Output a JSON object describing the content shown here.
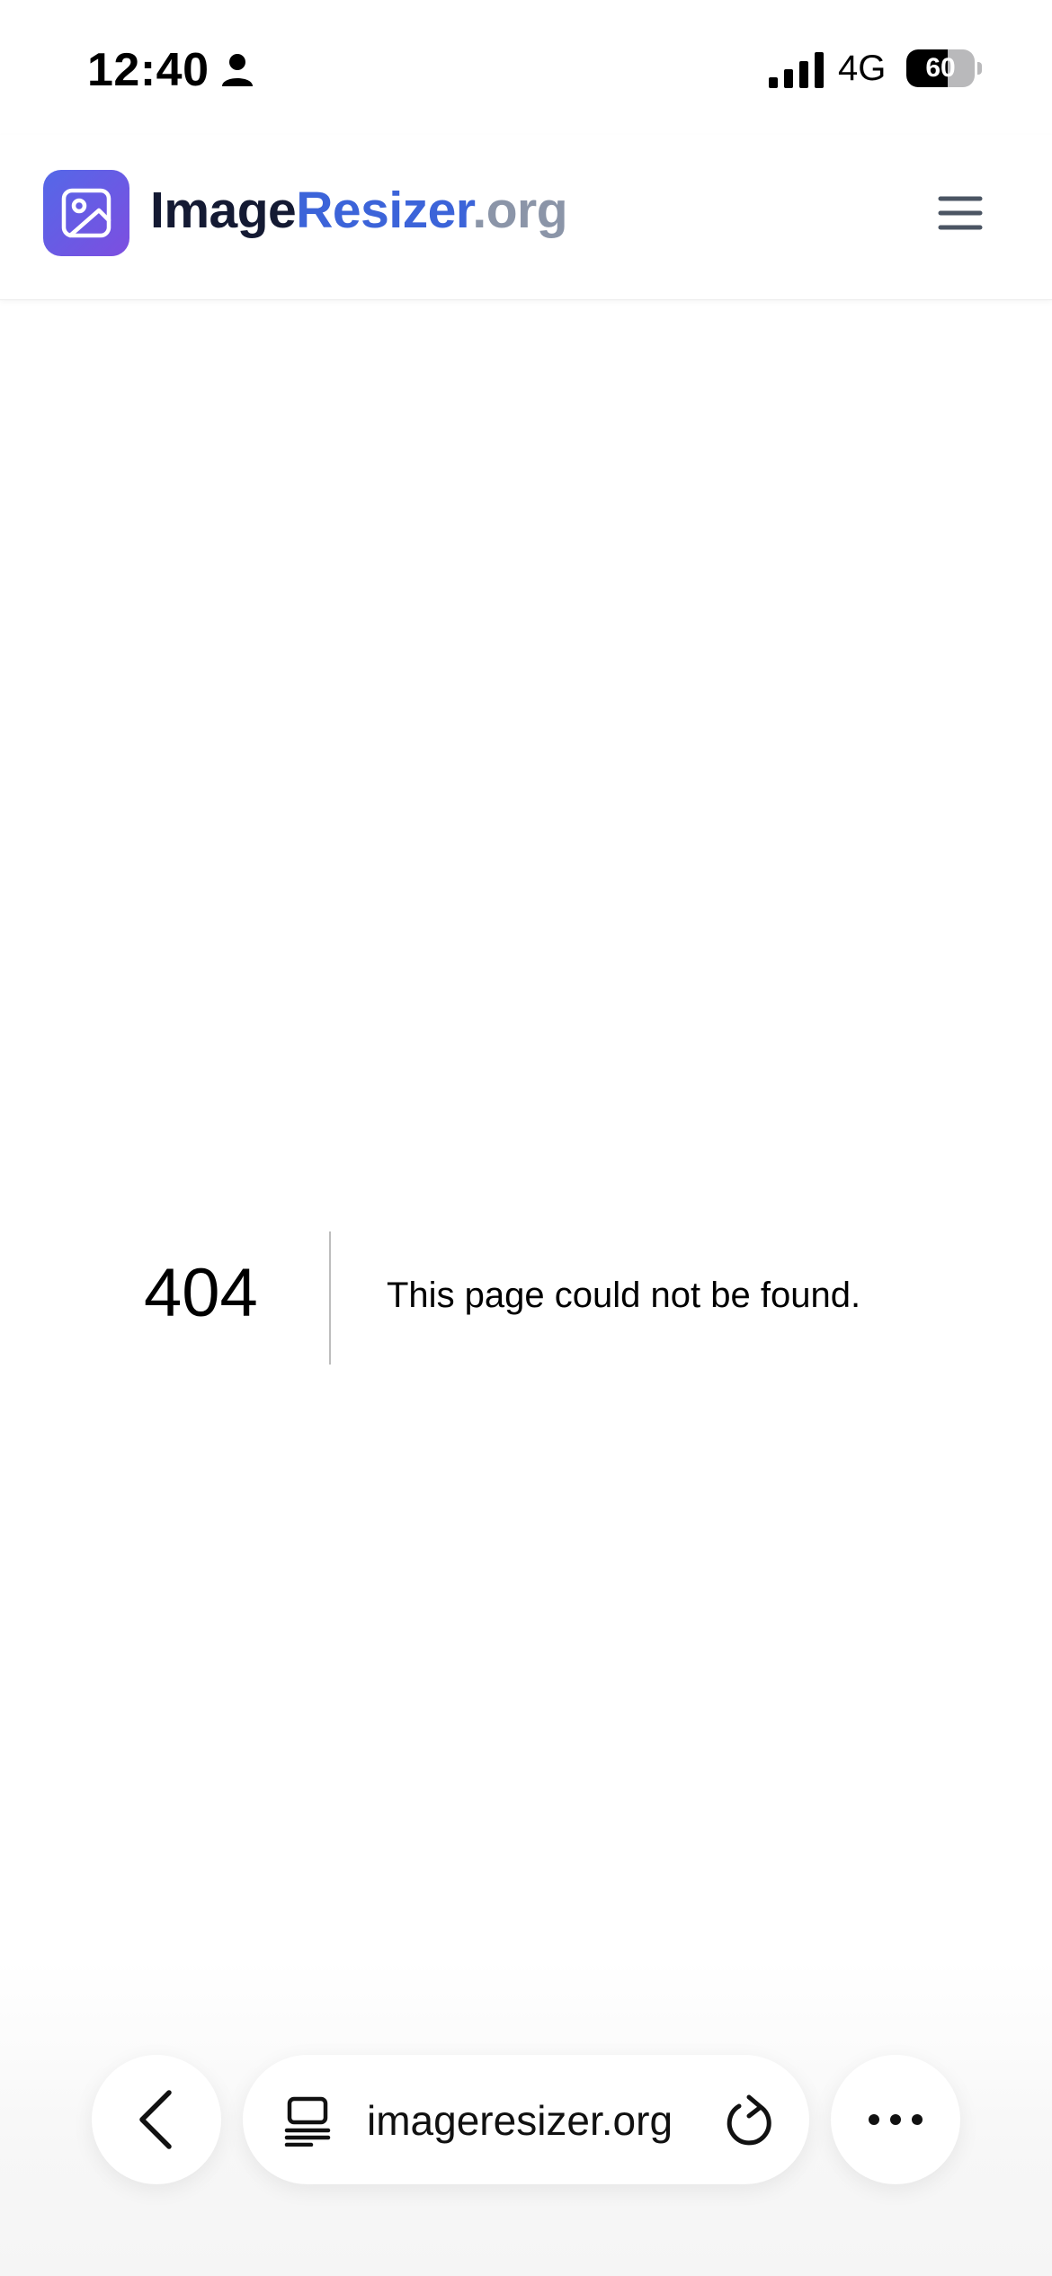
{
  "status_bar": {
    "time": "12:40",
    "network": "4G",
    "battery_level": "60",
    "battery_fraction": 0.6
  },
  "header": {
    "brand_part1": "Image",
    "brand_part2": "Resizer",
    "brand_part3": ".org",
    "colors": {
      "dark": "#141a33",
      "accent": "#3c64d9",
      "muted": "#8b95a8",
      "badge_start": "#5468e8",
      "badge_end": "#7d4ee0"
    }
  },
  "error": {
    "code": "404",
    "message": "This page could not be found."
  },
  "browser": {
    "url": "imageresizer.org"
  },
  "icons": [
    "person-icon",
    "signal-icon",
    "battery-icon",
    "image-icon",
    "hamburger-menu-icon",
    "back-chevron-icon",
    "tabs-icon",
    "reload-icon",
    "more-dots-icon"
  ]
}
